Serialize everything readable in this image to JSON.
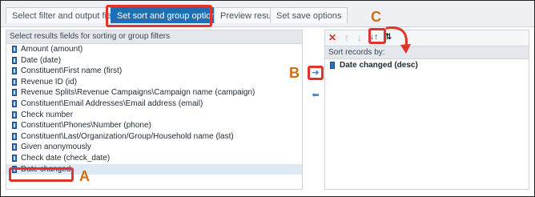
{
  "tabs": [
    {
      "label": "Select filter and output fields"
    },
    {
      "label": "Set sort and group options"
    },
    {
      "label": "Preview results"
    },
    {
      "label": "Set save options"
    }
  ],
  "left_panel": {
    "header": "Select results fields for sorting or group filters",
    "fields": [
      {
        "label": "Amount (amount)"
      },
      {
        "label": "Date (date)"
      },
      {
        "label": "Constituent\\First name (first)"
      },
      {
        "label": "Revenue ID (id)"
      },
      {
        "label": "Revenue Splits\\Revenue Campaigns\\Campaign name (campaign)"
      },
      {
        "label": "Constituent\\Email Addresses\\Email address (email)"
      },
      {
        "label": "Check number"
      },
      {
        "label": "Constituent\\Phones\\Number (phone)"
      },
      {
        "label": "Constituent\\Last/Organization/Group/Household name (last)"
      },
      {
        "label": "Given anonymously"
      },
      {
        "label": "Check date (check_date)"
      },
      {
        "label": "Date changed"
      }
    ],
    "selected_index": 11
  },
  "middle": {
    "move_right_icon": "arrow-right-icon",
    "move_left_icon": "arrow-left-icon"
  },
  "right_panel": {
    "toolbar_icons": [
      "delete-icon",
      "move-up-icon",
      "move-down-icon",
      "sort-descending-icon",
      "sort-ascending-icon"
    ],
    "header": "Sort records by:",
    "sort_items": [
      {
        "label": "Date changed (desc)"
      }
    ]
  },
  "callouts": {
    "a": "A",
    "b": "B",
    "c": "C"
  },
  "colors": {
    "highlight": "#e0332b",
    "callout": "#d06e14",
    "active_tab": "#1d6fb8"
  }
}
